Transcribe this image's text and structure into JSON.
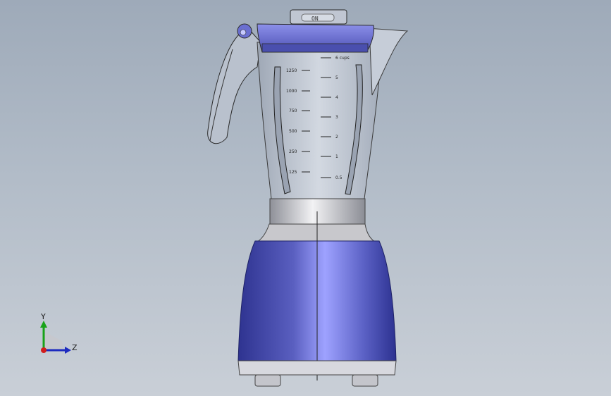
{
  "viewport": {
    "model": "blender",
    "colors": {
      "background_top": "#9eaab9",
      "background_bottom": "#c9cfd7",
      "body_blue": "#5a5fc0",
      "glass": "#c8d0dc",
      "metal": "#c8c8cc"
    }
  },
  "lid": {
    "label": "ON"
  },
  "jar_scale": {
    "left_ml": [
      "1250",
      "1000",
      "750",
      "500",
      "250",
      "125"
    ],
    "right_cups": [
      "6 cups",
      "5",
      "4",
      "3",
      "2",
      "1",
      "0.5"
    ]
  },
  "triad": {
    "y_label": "Y",
    "z_label": "Z",
    "icon": "coordinate-triad-icon"
  }
}
